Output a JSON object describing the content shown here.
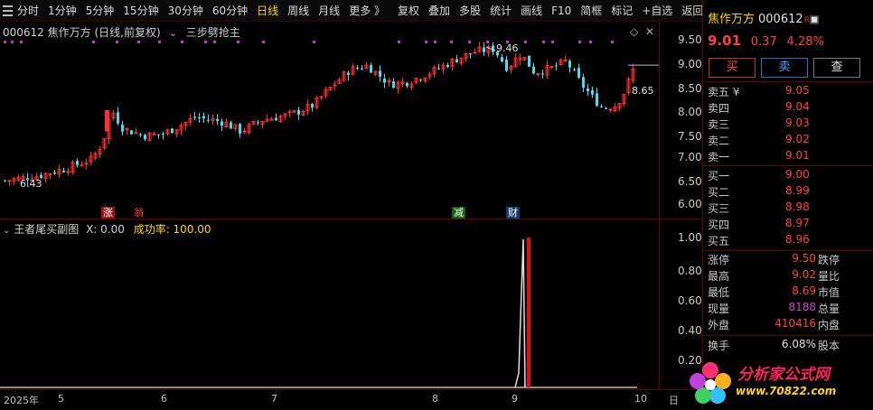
{
  "toolbar": {
    "periods": [
      "分时",
      "1分钟",
      "5分钟",
      "15分钟",
      "30分钟",
      "60分钟",
      "日线",
      "周线",
      "月线",
      "更多 》"
    ],
    "active_period": "日线",
    "tools": [
      "复权",
      "叠加",
      "多股",
      "统计",
      "画线",
      "F10",
      "简框",
      "标记",
      "+自选",
      "返回"
    ]
  },
  "main_chart": {
    "stock_code": "000612",
    "stock_name": "焦作万方",
    "mode": "(日线,前复权)",
    "indicator": "三步劈抢主",
    "high_marker": "9.46",
    "low_marker": "6.43",
    "last_marker": "8.65",
    "signal_badges": [
      "涨",
      "翁",
      "减",
      "财"
    ]
  },
  "price_axis": [
    "9.50",
    "9.00",
    "8.50",
    "8.00",
    "7.50",
    "7.00",
    "6.50",
    "6.00"
  ],
  "sub_chart": {
    "name": "王者尾买副图",
    "x_label": "X: 0.00",
    "success_label": "成功率: 100.00",
    "axis": [
      "1.00",
      "0.80",
      "0.60",
      "0.40",
      "0.20"
    ]
  },
  "date_axis": [
    "2025年",
    "5",
    "6",
    "7",
    "8",
    "9",
    "10",
    "日"
  ],
  "panel": {
    "name": "焦作万方",
    "code": "000612",
    "tag": "R🔲",
    "price": "9.01",
    "change": "0.37",
    "pct": "4.28%",
    "buy_btn": "买",
    "sell_btn": "卖",
    "query_btn": "查",
    "asks": [
      {
        "label": "卖五 ¥",
        "price": "9.05"
      },
      {
        "label": "卖四",
        "price": "9.04"
      },
      {
        "label": "卖三",
        "price": "9.03"
      },
      {
        "label": "卖二",
        "price": "9.02"
      },
      {
        "label": "卖一",
        "price": "9.01"
      }
    ],
    "bids": [
      {
        "label": "买一",
        "price": "9.00"
      },
      {
        "label": "买二",
        "price": "8.99"
      },
      {
        "label": "买三",
        "price": "8.98"
      },
      {
        "label": "买四",
        "price": "8.97"
      },
      {
        "label": "买五",
        "price": "8.96"
      }
    ],
    "stats": [
      {
        "label": "涨停",
        "value": "9.50",
        "label2": "跌停",
        "color": "red"
      },
      {
        "label": "最高",
        "value": "9.02",
        "label2": "量比",
        "color": "red"
      },
      {
        "label": "最低",
        "value": "8.69",
        "label2": "市值",
        "color": "red"
      },
      {
        "label": "现量",
        "value": "8188",
        "label2": "总量",
        "color": "purple"
      },
      {
        "label": "外盘",
        "value": "410416",
        "label2": "内盘",
        "color": "red"
      },
      {
        "label": "换手",
        "value": "6.08%",
        "label2": "股本",
        "color": "white"
      }
    ]
  },
  "logo": {
    "text": "分析家公式网",
    "url": "www.70822.com"
  },
  "colors": {
    "up": "#ff3030",
    "down": "#40e0f0",
    "accent": "#ffd700",
    "frame": "#6a0000"
  }
}
